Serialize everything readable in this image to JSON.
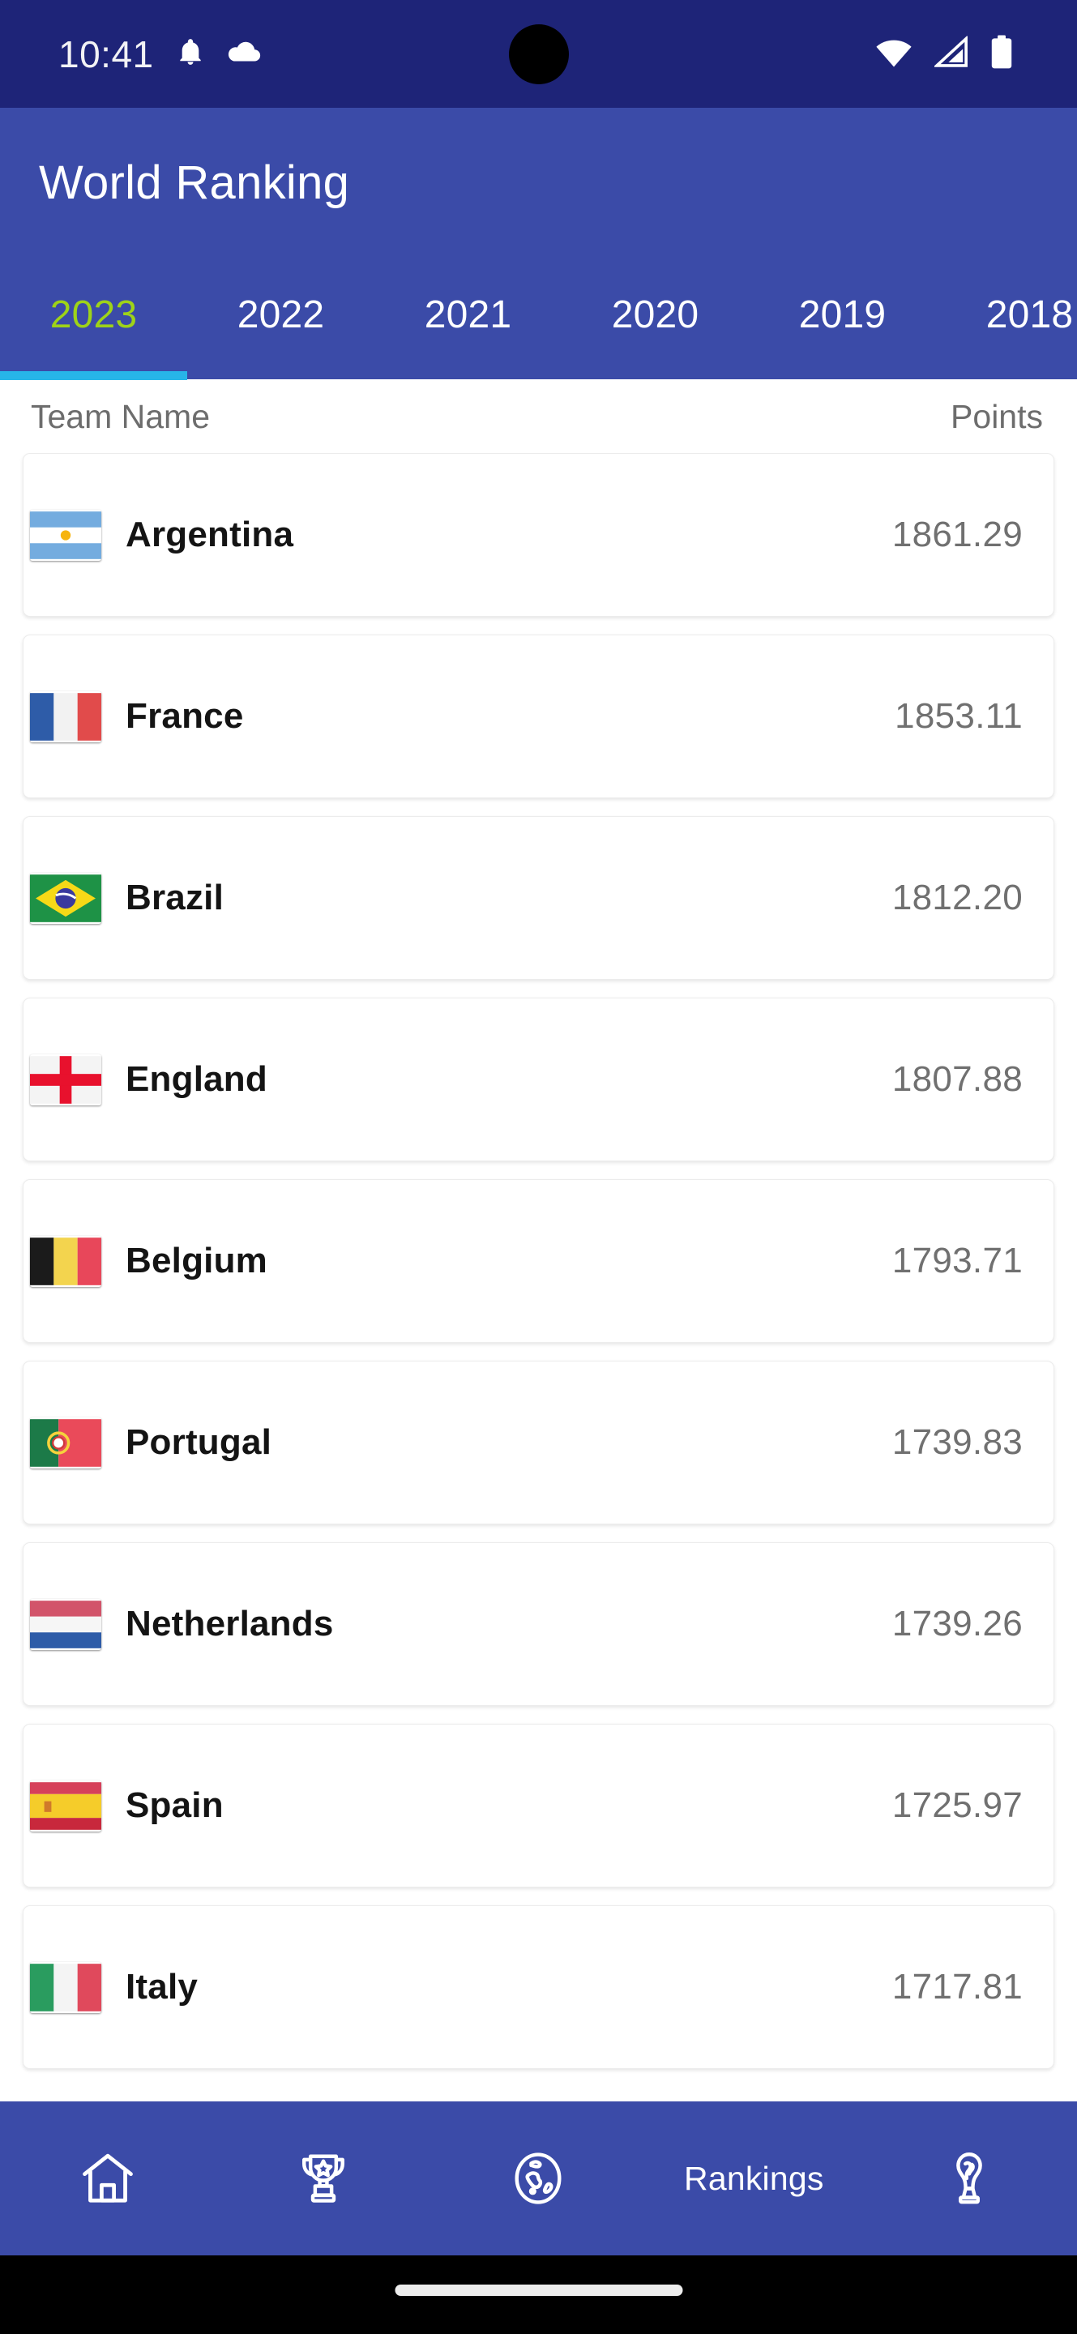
{
  "status_bar": {
    "time": "10:41",
    "icons": [
      "bell-icon",
      "cloud-icon",
      "wifi-icon",
      "cellular-signal-icon",
      "battery-icon"
    ],
    "background_color": "#1e2478"
  },
  "app_bar": {
    "title": "World Ranking",
    "background_color": "#3b4ba8",
    "title_color": "#ffffff"
  },
  "tabs": {
    "active_index": 0,
    "active_color": "#9ed318",
    "inactive_color": "#ffffff",
    "indicator_color": "#27b5e8",
    "items": [
      {
        "label": "2023"
      },
      {
        "label": "2022"
      },
      {
        "label": "2021"
      },
      {
        "label": "2020"
      },
      {
        "label": "2019"
      },
      {
        "label": "2018"
      }
    ]
  },
  "list_header": {
    "team_label": "Team Name",
    "points_label": "Points"
  },
  "rankings": [
    {
      "team": "Argentina",
      "points": "1861.29",
      "flag": "argentina-flag"
    },
    {
      "team": "France",
      "points": "1853.11",
      "flag": "france-flag"
    },
    {
      "team": "Brazil",
      "points": "1812.20",
      "flag": "brazil-flag"
    },
    {
      "team": "England",
      "points": "1807.88",
      "flag": "england-flag"
    },
    {
      "team": "Belgium",
      "points": "1793.71",
      "flag": "belgium-flag"
    },
    {
      "team": "Portugal",
      "points": "1739.83",
      "flag": "portugal-flag"
    },
    {
      "team": "Netherlands",
      "points": "1739.26",
      "flag": "netherlands-flag"
    },
    {
      "team": "Spain",
      "points": "1725.97",
      "flag": "spain-flag"
    },
    {
      "team": "Italy",
      "points": "1717.81",
      "flag": "italy-flag"
    }
  ],
  "bottom_nav": {
    "background_color": "#3b4ba8",
    "active_index": 3,
    "items": [
      {
        "label": "",
        "icon": "home-icon"
      },
      {
        "label": "",
        "icon": "trophy-icon"
      },
      {
        "label": "",
        "icon": "globe-icon"
      },
      {
        "label": "Rankings",
        "icon": ""
      },
      {
        "label": "",
        "icon": "world-cup-trophy-icon"
      }
    ]
  }
}
